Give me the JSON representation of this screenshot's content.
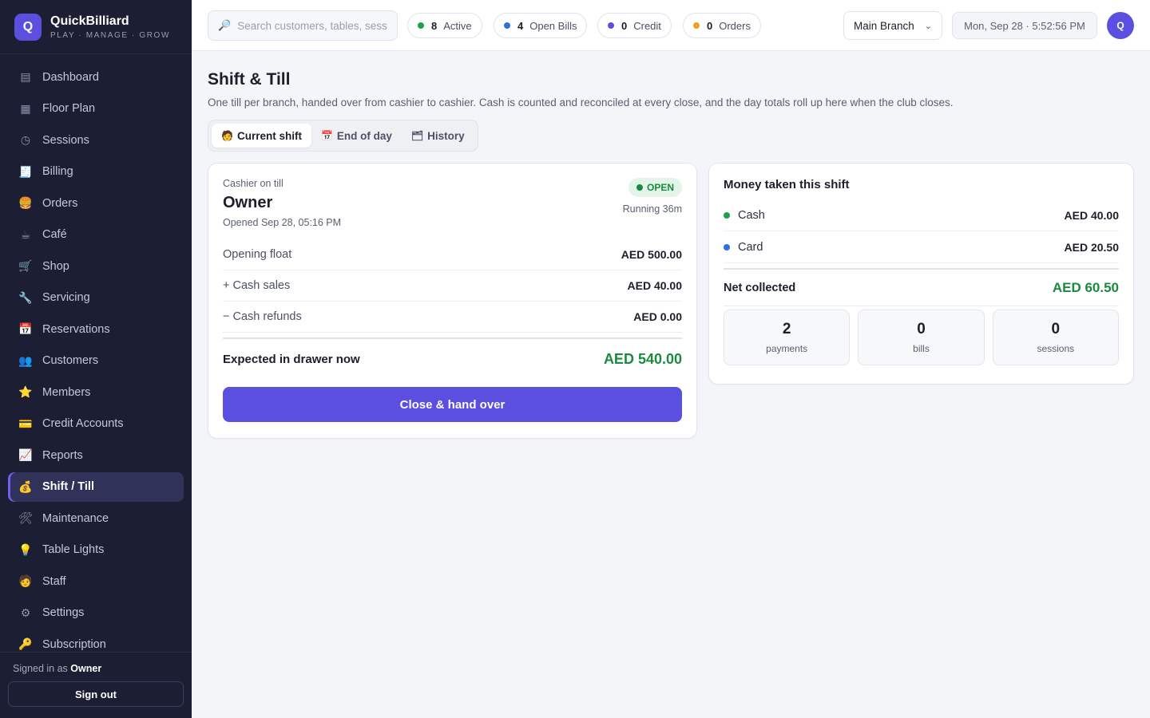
{
  "brand": {
    "logo_letter": "Q",
    "name": "QuickBilliard",
    "tagline": "PLAY · MANAGE · GROW"
  },
  "sidebar": {
    "items": [
      {
        "label": "Dashboard",
        "icon": "▤"
      },
      {
        "label": "Floor Plan",
        "icon": "▦"
      },
      {
        "label": "Sessions",
        "icon": "◷"
      },
      {
        "label": "Billing",
        "icon": "🧾"
      },
      {
        "label": "Orders",
        "icon": "🍔"
      },
      {
        "label": "Café",
        "icon": "☕"
      },
      {
        "label": "Shop",
        "icon": "🛒"
      },
      {
        "label": "Servicing",
        "icon": "🔧"
      },
      {
        "label": "Reservations",
        "icon": "📅"
      },
      {
        "label": "Customers",
        "icon": "👥"
      },
      {
        "label": "Members",
        "icon": "⭐"
      },
      {
        "label": "Credit Accounts",
        "icon": "💳"
      },
      {
        "label": "Reports",
        "icon": "📈"
      },
      {
        "label": "Shift / Till",
        "icon": "💰"
      },
      {
        "label": "Maintenance",
        "icon": "🛠"
      },
      {
        "label": "Table Lights",
        "icon": "💡"
      },
      {
        "label": "Staff",
        "icon": "🧑"
      },
      {
        "label": "Settings",
        "icon": "⚙"
      },
      {
        "label": "Subscription",
        "icon": "🔑"
      }
    ],
    "active_index": 13,
    "signed_in_prefix": "Signed in as",
    "signed_in_user": "Owner",
    "sign_out_label": "Sign out"
  },
  "topbar": {
    "search_placeholder": "Search customers, tables, sessions",
    "pills": [
      {
        "count": "8",
        "label": "Active",
        "color": "#1aa34a"
      },
      {
        "count": "4",
        "label": "Open Bills",
        "color": "#2f6fe0"
      },
      {
        "count": "0",
        "label": "Credit",
        "color": "#5b4fe0"
      },
      {
        "count": "0",
        "label": "Orders",
        "color": "#f0a020"
      }
    ],
    "branch": "Main Branch",
    "datetime": "Mon, Sep 28 · 5:52:56 PM",
    "avatar_letter": "Q"
  },
  "page": {
    "title": "Shift & Till",
    "subtitle": "One till per branch, handed over from cashier to cashier. Cash is counted and reconciled at every close, and the day totals roll up here when the club closes.",
    "tabs": [
      {
        "label": "Current shift",
        "icon": "🧑"
      },
      {
        "label": "End of day",
        "icon": "📅"
      },
      {
        "label": "History",
        "icon": "🗂"
      }
    ]
  },
  "shift": {
    "cashier_label": "Cashier on till",
    "cashier_name": "Owner",
    "opened_at": "Opened Sep 28, 05:16 PM",
    "status": "OPEN",
    "running": "Running 36m",
    "rows": [
      {
        "label": "Opening float",
        "amount": "AED 500.00"
      },
      {
        "label": "+ Cash sales",
        "amount": "AED 40.00"
      },
      {
        "label": "− Cash refunds",
        "amount": "AED 0.00"
      }
    ],
    "expected_label": "Expected in drawer now",
    "expected_amount": "AED 540.00",
    "close_button": "Close & hand over"
  },
  "money": {
    "title": "Money taken this shift",
    "rows": [
      {
        "label": "Cash",
        "amount": "AED 40.00",
        "color": "#1aa34a"
      },
      {
        "label": "Card",
        "amount": "AED 20.50",
        "color": "#2f6fe0"
      }
    ],
    "net_label": "Net collected",
    "net_amount": "AED 60.50",
    "stats": [
      {
        "value": "2",
        "label": "payments"
      },
      {
        "value": "0",
        "label": "bills"
      },
      {
        "value": "0",
        "label": "sessions"
      }
    ]
  }
}
